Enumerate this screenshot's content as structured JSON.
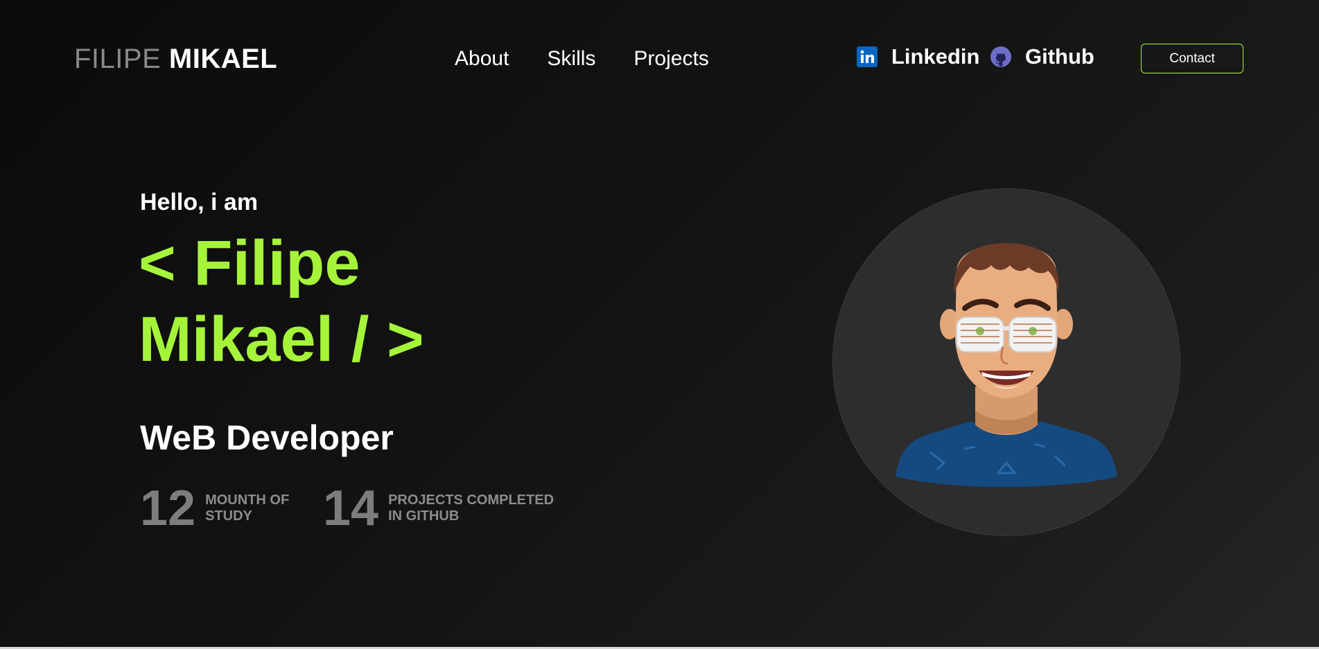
{
  "header": {
    "logo_first": "FILIPE",
    "logo_last": "MIKAEL",
    "nav": [
      "About",
      "Skills",
      "Projects"
    ],
    "social": [
      {
        "label": "Linkedin",
        "icon": "linkedin-icon"
      },
      {
        "label": "Github",
        "icon": "github-icon"
      }
    ],
    "contact_label": "Contact"
  },
  "hero": {
    "greeting": "Hello, i am",
    "name_line_1": "< Filipe",
    "name_line_2": "Mikael / >",
    "role": "WeB Developer",
    "stats": [
      {
        "number": "12",
        "label_line_1": "MOUNTH OF",
        "label_line_2": "STUDY"
      },
      {
        "number": "14",
        "label_line_1": "PROJECTS COMPLETED",
        "label_line_2": "IN GITHUB"
      }
    ]
  },
  "colors": {
    "accent": "#a6f43a",
    "background": "#111111",
    "muted": "#7d7d7d",
    "linkedin": "#0a66c2",
    "github": "#6e6ec9",
    "shirt": "#154a80"
  }
}
